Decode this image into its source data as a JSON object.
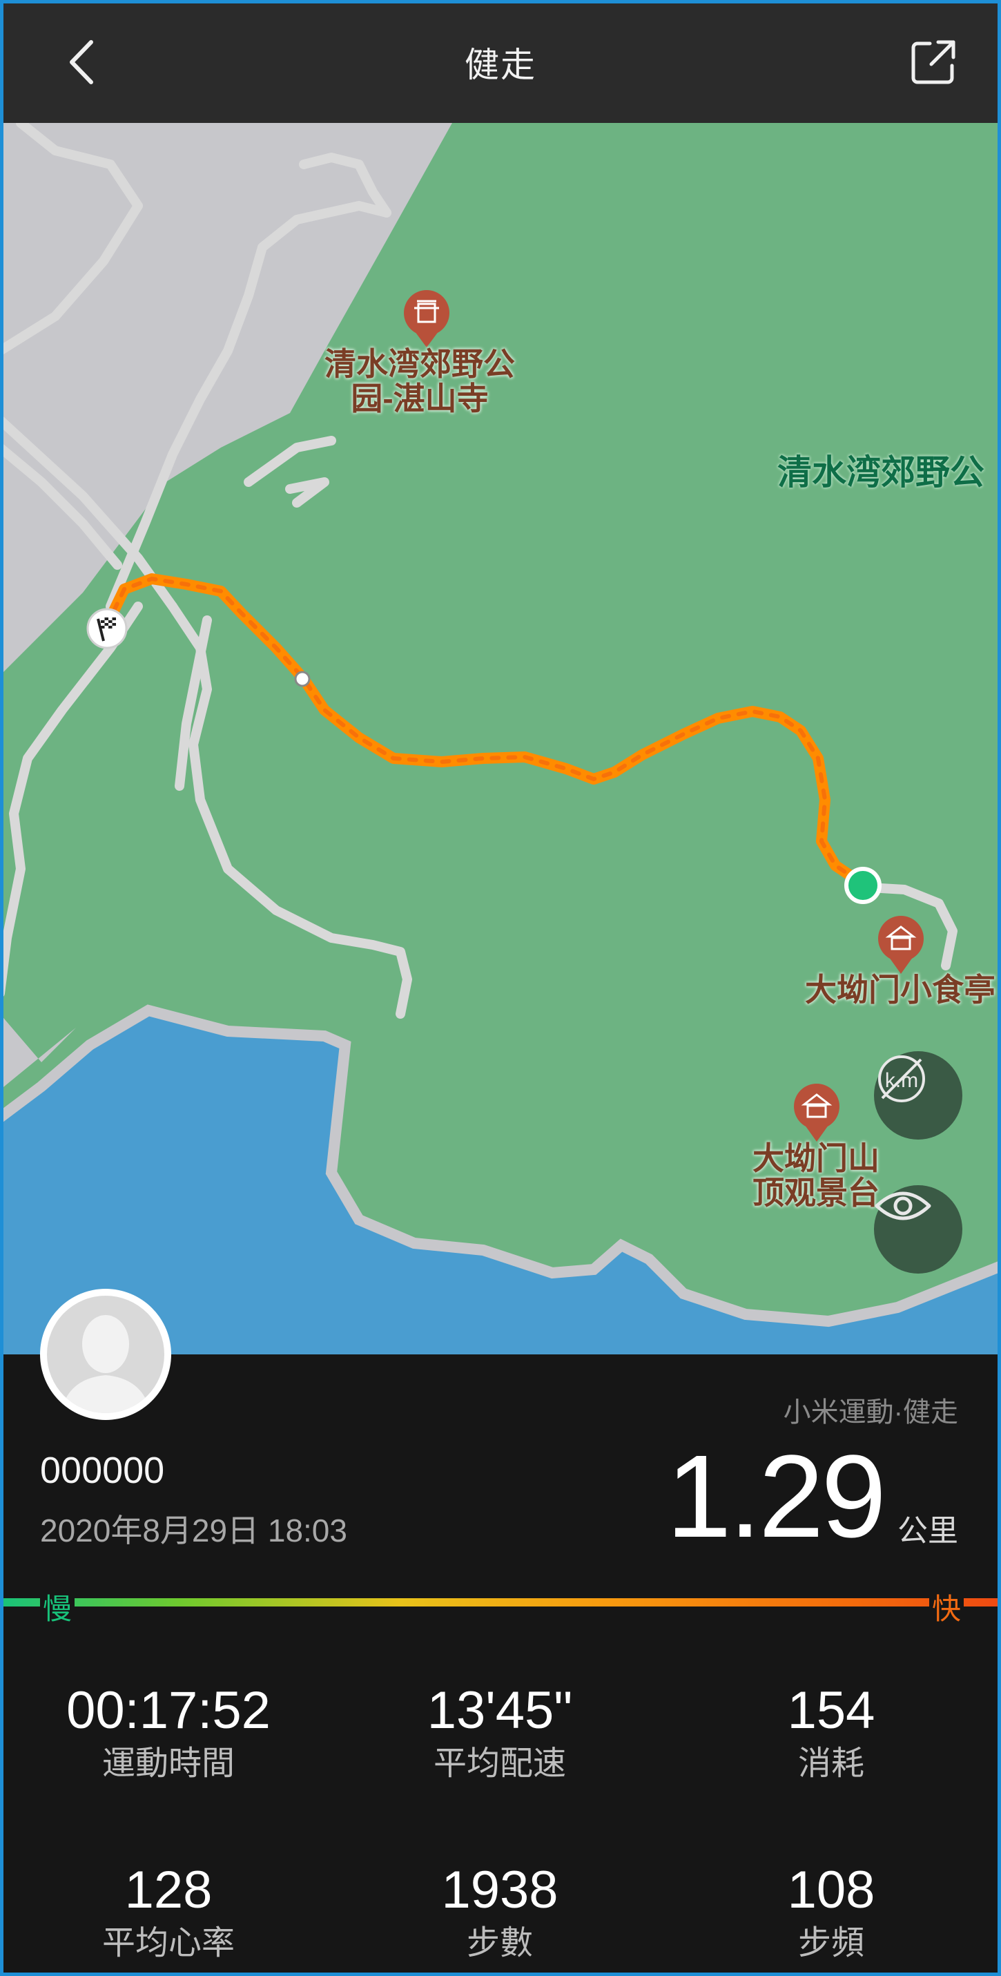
{
  "header": {
    "title": "健走"
  },
  "map": {
    "pois": [
      {
        "name_line1": "清水湾郊野公",
        "name_line2": "园-湛山寺"
      },
      {
        "name_line1": "大坳门小食亭",
        "name_line2": ""
      },
      {
        "name_line1": "大坳门山",
        "name_line2": "顶观景台"
      }
    ],
    "area_label": "清水湾郊野公",
    "colors": {
      "land": "#6db382",
      "urban": "#c7c7cb",
      "water": "#4a9dd0",
      "route_start": "#ff8c00",
      "route_end": "#1fc37a"
    }
  },
  "user": {
    "name": "000000",
    "datetime": "2020年8月29日 18:03"
  },
  "summary": {
    "app_label": "小米運動·健走",
    "distance": "1.29",
    "distance_unit": "公里",
    "speed_slow": "慢",
    "speed_fast": "快"
  },
  "stats": [
    {
      "value": "00:17:52",
      "label": "運動時間"
    },
    {
      "value": "13'45\"",
      "label": "平均配速"
    },
    {
      "value": "154",
      "label": "消耗"
    },
    {
      "value": "128",
      "label": "平均心率"
    },
    {
      "value": "1938",
      "label": "步數"
    },
    {
      "value": "108",
      "label": "步頻"
    }
  ]
}
